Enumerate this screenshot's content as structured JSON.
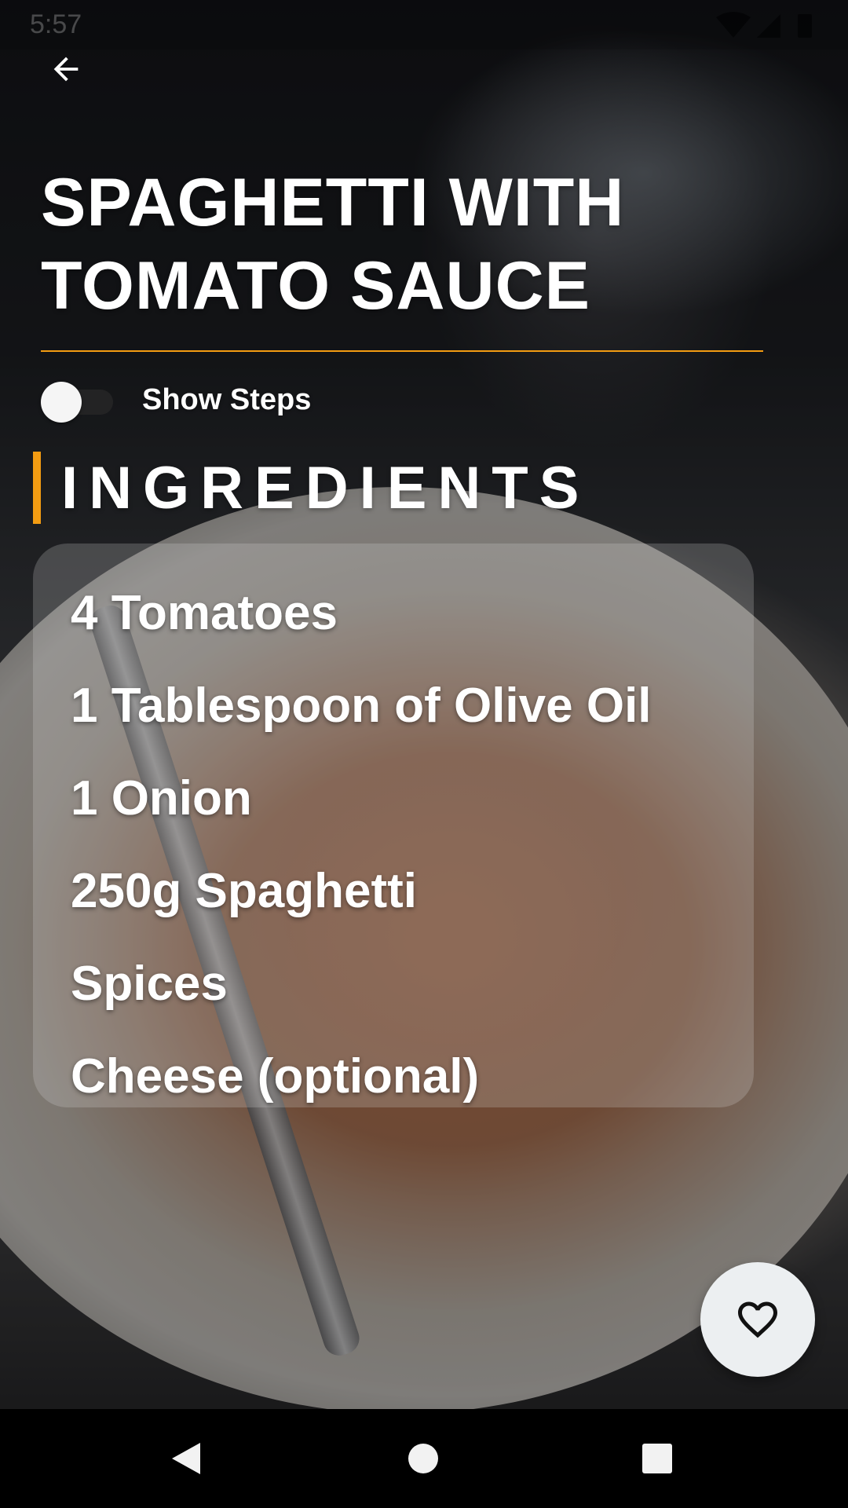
{
  "status_bar": {
    "time": "5:57"
  },
  "recipe": {
    "title": "SPAGHETTI WITH TOMATO SAUCE",
    "show_steps_label": "Show Steps",
    "show_steps_enabled": false,
    "section_title": "INGREDIENTS",
    "ingredients": [
      "4 Tomatoes",
      "1 Tablespoon of Olive Oil",
      "1 Onion",
      "250g Spaghetti",
      "Spices",
      "Cheese (optional)"
    ]
  },
  "icons": {
    "back": "arrow-left-icon",
    "favorite": "heart-outline-icon",
    "nav_back": "triangle-back-icon",
    "nav_home": "circle-home-icon",
    "nav_recents": "square-recents-icon"
  },
  "colors": {
    "accent": "#f39c12",
    "text": "#ffffff",
    "fab_background": "#eceff1"
  }
}
